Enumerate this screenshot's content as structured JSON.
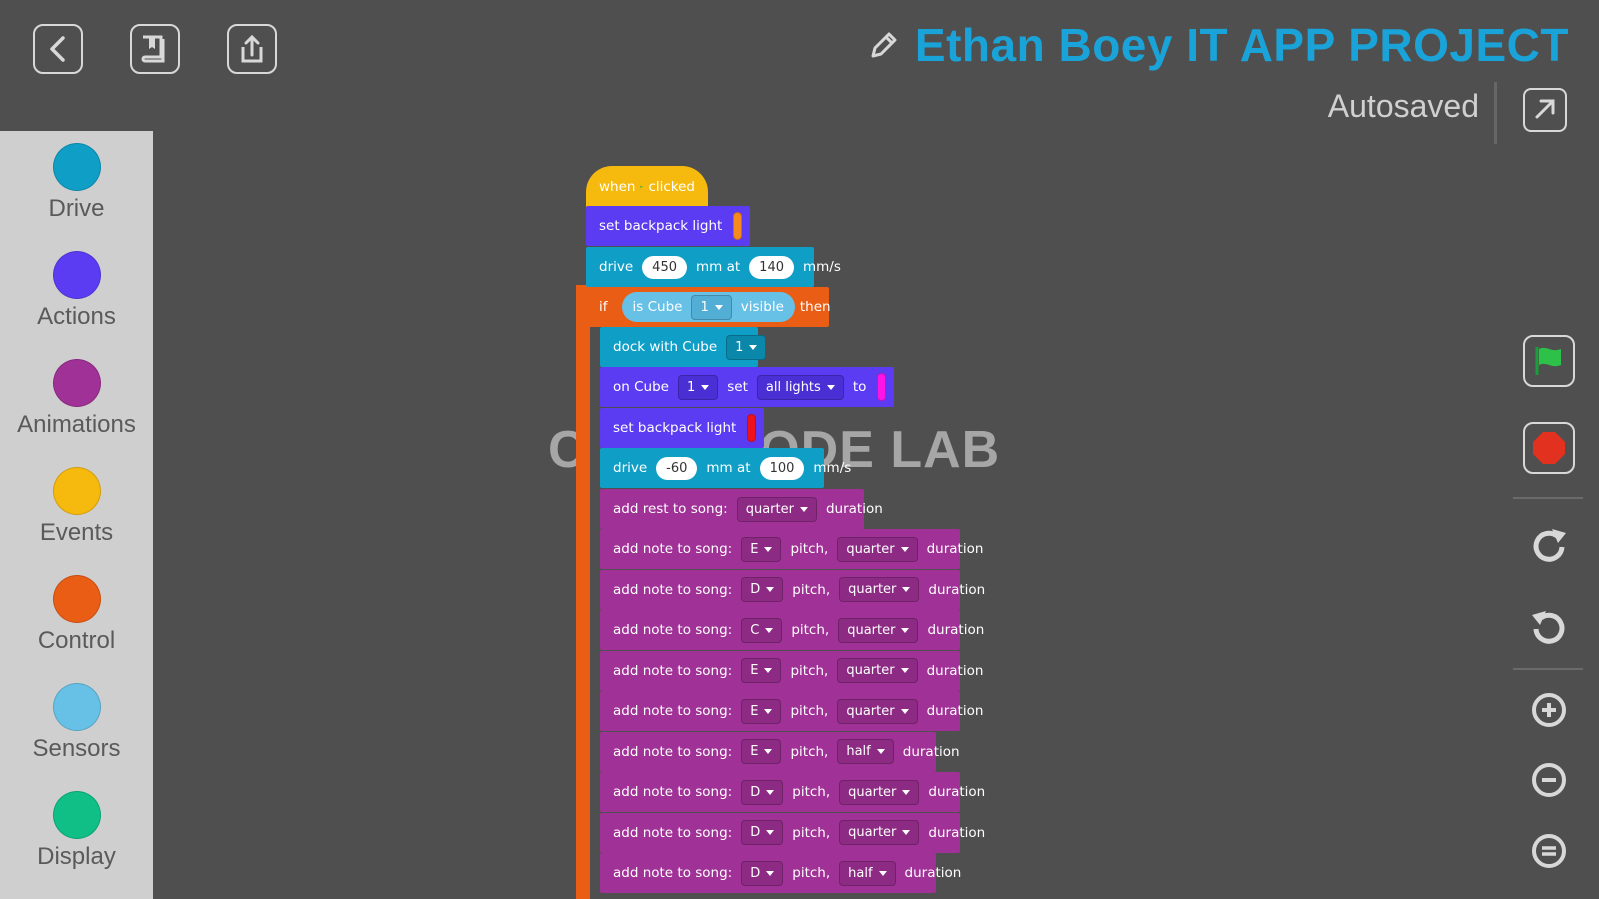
{
  "header": {
    "project_title": "Ethan Boey IT APP PROJECT",
    "save_status": "Autosaved",
    "icons": [
      "back-icon",
      "book-icon",
      "share-icon",
      "pencil-icon",
      "expand-icon"
    ]
  },
  "sidebar": {
    "categories": [
      {
        "label": "Drive",
        "color": "#0f9ec6"
      },
      {
        "label": "Actions",
        "color": "#5b3cf2"
      },
      {
        "label": "Animations",
        "color": "#a03196"
      },
      {
        "label": "Events",
        "color": "#f6b90d"
      },
      {
        "label": "Control",
        "color": "#e95d15"
      },
      {
        "label": "Sensors",
        "color": "#67c0e6"
      },
      {
        "label": "Display",
        "color": "#0fbf86"
      }
    ]
  },
  "watermark": {
    "text": "C     O CODE LAB"
  },
  "blocks": {
    "when_clicked": {
      "when": "when",
      "clicked": "clicked"
    },
    "backpack1": {
      "label": "set backpack light",
      "color": "#f78a1d"
    },
    "drive1": {
      "label": "drive",
      "distance": "450",
      "mm_at": "mm at",
      "speed": "140",
      "unit": "mm/s"
    },
    "if_block": {
      "if": "if",
      "is_cube": "is Cube",
      "cube": "1",
      "visible": "visible",
      "then": "then"
    },
    "dock": {
      "label": "dock with Cube",
      "cube": "1"
    },
    "on_cube": {
      "on_cube": "on Cube",
      "cube": "1",
      "set": "set",
      "lights": "all lights",
      "to": "to",
      "color": "#ff14e6"
    },
    "backpack2": {
      "label": "set backpack light",
      "color": "#f0121b"
    },
    "drive2": {
      "label": "drive",
      "distance": "-60",
      "mm_at": "mm at",
      "speed": "100",
      "unit": "mm/s"
    },
    "rest": {
      "label": "add rest to song:",
      "duration": "quarter",
      "duration_label": "duration"
    },
    "note_label": "add note to song:",
    "pitch_label": "pitch,",
    "duration_label": "duration",
    "notes": [
      {
        "pitch": "E",
        "duration": "quarter"
      },
      {
        "pitch": "D",
        "duration": "quarter"
      },
      {
        "pitch": "C",
        "duration": "quarter"
      },
      {
        "pitch": "E",
        "duration": "quarter"
      },
      {
        "pitch": "E",
        "duration": "quarter"
      },
      {
        "pitch": "E",
        "duration": "half"
      },
      {
        "pitch": "D",
        "duration": "quarter"
      },
      {
        "pitch": "D",
        "duration": "quarter"
      },
      {
        "pitch": "D",
        "duration": "half"
      }
    ]
  },
  "tools": {
    "icons": [
      "green-flag-icon",
      "stop-icon",
      "redo-icon",
      "undo-icon",
      "zoom-in-icon",
      "zoom-out-icon",
      "zoom-reset-icon"
    ]
  }
}
